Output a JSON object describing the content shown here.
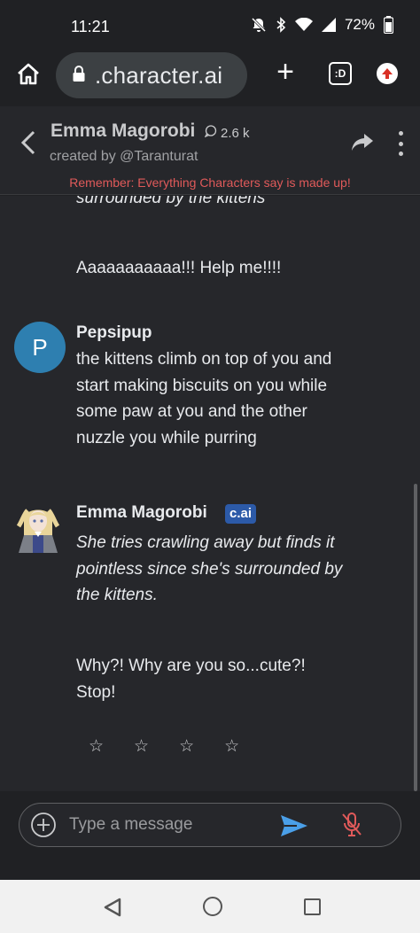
{
  "status_bar": {
    "time": "11:21",
    "battery": "72%",
    "icons": [
      "mute-bell-icon",
      "bluetooth-icon",
      "wifi-icon",
      "signal-icon",
      "battery-icon"
    ]
  },
  "browser": {
    "url": ".character.ai",
    "tab_label": ":D",
    "icons": [
      "home-icon",
      "lock-icon",
      "plus-icon",
      "tab-switcher-icon",
      "update-icon"
    ]
  },
  "chat_header": {
    "character_name": "Emma Magorobi",
    "chat_count": "2.6 k",
    "created_by": "created by @Taranturat",
    "warning": "Remember: Everything Characters say is made up!"
  },
  "messages": {
    "partial_top": "surrounded by the kittens",
    "bot_line_1": "Aaaaaaaaaaa!!! Help me!!!!",
    "user": {
      "avatar_letter": "P",
      "name": "Pepsipup",
      "text": "the kittens climb on top of you and start making biscuits on you while some paw at you and the other nuzzle you while purring"
    },
    "bot": {
      "name": "Emma Magorobi",
      "badge": "c.ai",
      "action_text": "She tries crawling away but finds it pointless since she's surrounded by the kittens.",
      "speech_text": "Why?! Why are you so...cute?! Stop!"
    },
    "rating_stars": [
      "☆",
      "☆",
      "☆",
      "☆"
    ]
  },
  "input": {
    "placeholder": "Type a message",
    "value": ""
  },
  "colors": {
    "background": "#26272b",
    "warning": "#e05a5a",
    "user_avatar": "#2e7fb0",
    "badge": "#2c5aa8",
    "send": "#4a9fe8",
    "mic_muted": "#e05a5a"
  }
}
